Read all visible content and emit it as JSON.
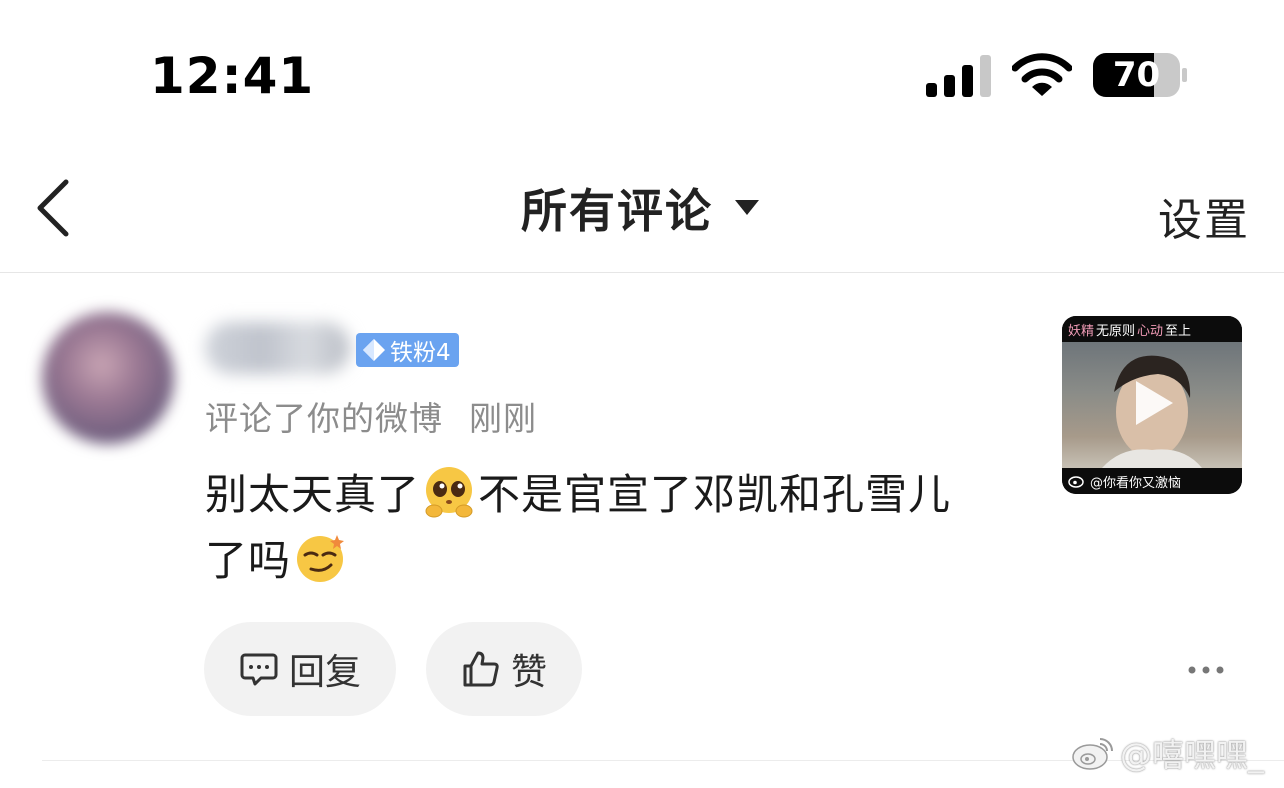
{
  "status_bar": {
    "time": "12:41",
    "battery_level": "70",
    "signal_bars_active": 3,
    "signal_bars_total": 4
  },
  "nav": {
    "back_icon": "chevron-left-icon",
    "title": "所有评论",
    "title_dropdown_icon": "caret-down-icon",
    "settings_label": "设置"
  },
  "comment": {
    "fan_badge": "铁粉4",
    "action_text": "评论了你的微博",
    "time": "刚刚",
    "text_part1": "别太天真了",
    "emoji1": "pleading-face-emoji",
    "text_part2": "不是官宣了邓凯和孔雪儿",
    "text_part3": "了吗",
    "emoji2": "smirk-face-emoji",
    "thumbnail": {
      "caption_pink_1": "妖精",
      "caption_white_1": "无原则",
      "caption_pink_2": "心动",
      "caption_white_2": "至上",
      "footer": "@你看你又激恼"
    },
    "reply_label": "回复",
    "like_label": "赞",
    "more_icon": "more-dots-icon"
  },
  "watermark": {
    "text": "@嘻嘿嘿_"
  },
  "colors": {
    "badge_blue": "#6aa3f0",
    "meta_gray": "#8c8c8c",
    "pill_bg": "#f2f2f2"
  }
}
